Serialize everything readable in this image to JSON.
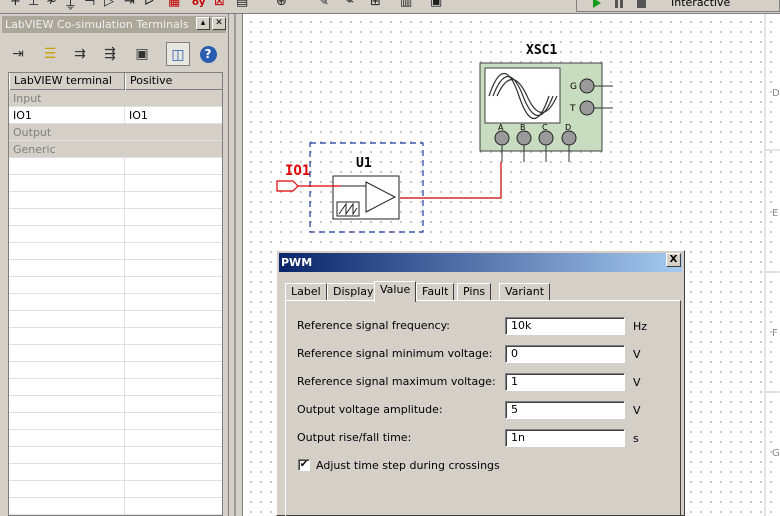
{
  "toolbar": {
    "mode_label": "Interactive",
    "glyphs": [
      "+",
      "⊥",
      "≁",
      "⏚",
      "⊣",
      "▷",
      "⇥",
      "ᐅ",
      "▦",
      "oy",
      "⊠",
      "▤",
      "⊕",
      "✎",
      "⌁",
      "⊞",
      "▥",
      "▣"
    ],
    "glyph_hot": "#c00000"
  },
  "left_panel": {
    "title": "LabVIEW Co-simulation Terminals",
    "columns": [
      "LabVIEW terminal",
      "Positive connection"
    ],
    "rows": [
      {
        "type": "section",
        "c1": "Input",
        "c2": ""
      },
      {
        "type": "row",
        "c1": "IO1",
        "c2": "IO1"
      },
      {
        "type": "section",
        "c1": "Output",
        "c2": ""
      },
      {
        "type": "section",
        "c1": "Generic",
        "c2": ""
      }
    ],
    "help_glyph": "?"
  },
  "schematic": {
    "oscilloscope_label": "XSC1",
    "oscilloscope_pins_right": [
      "G",
      "T"
    ],
    "oscilloscope_pins_bottom": [
      "A",
      "B",
      "C",
      "D"
    ],
    "component_label": "U1",
    "port_label": "IO1",
    "ruler_letters": [
      "D",
      "E",
      "F",
      "G"
    ],
    "wire_color": "#cc0000",
    "port_color": "#e00000"
  },
  "dialog": {
    "title": "PWM",
    "close_glyph": "X",
    "tabs": [
      "Label",
      "Display",
      "Value",
      "Fault",
      "Pins",
      "Variant"
    ],
    "active_tab": "Value",
    "fields": [
      {
        "label": "Reference signal frequency:",
        "value": "10k",
        "unit": "Hz"
      },
      {
        "label": "Reference signal minimum voltage:",
        "value": "0",
        "unit": "V"
      },
      {
        "label": "Reference signal maximum voltage:",
        "value": "1",
        "unit": "V"
      },
      {
        "label": "Output voltage amplitude:",
        "value": "5",
        "unit": "V"
      },
      {
        "label": "Output rise/fall time:",
        "value": "1n",
        "unit": "s"
      }
    ],
    "checkbox_label": "Adjust time step during crossings",
    "checkbox_checked": true,
    "checkbox_mark": "✔"
  }
}
